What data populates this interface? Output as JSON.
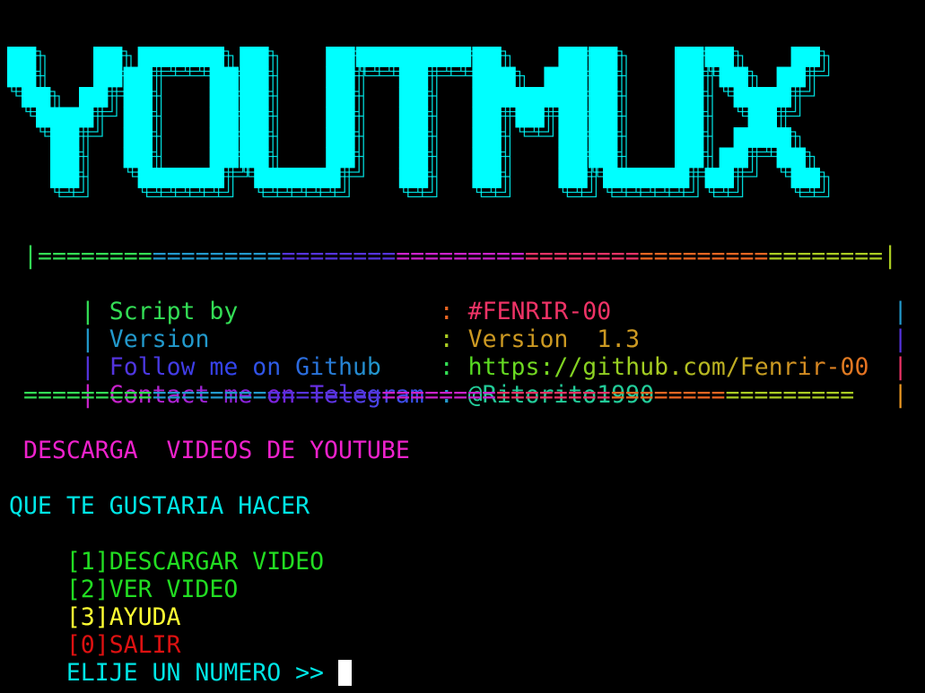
{
  "banner": {
    "title": "YOUTMUX",
    "color": "#00ffff"
  },
  "info_box": {
    "border_top": "|===========================================================|",
    "border_bottom": "==========================================================",
    "rows": [
      {
        "label": "Script by",
        "value": "#FENRIR-00"
      },
      {
        "label": "Version",
        "value": "Version  1.3"
      },
      {
        "label": "Follow me on Github",
        "value": "https://github.com/Fenrir-00"
      },
      {
        "label": "Contact me on Telegram",
        "value": "@Ritorito1990"
      }
    ]
  },
  "subtitle": "DESCARGA  VIDEOS DE YOUTUBE",
  "menu": {
    "prompt_title": "QUE TE GUSTARIA HACER",
    "options": [
      {
        "key": "[1]",
        "label": "DESCARGAR VIDEO",
        "color": "#22dd22"
      },
      {
        "key": "[2]",
        "label": "VER VIDEO",
        "color": "#22dd22"
      },
      {
        "key": "[3]",
        "label": "AYUDA",
        "color": "#ffff33"
      },
      {
        "key": "[0]",
        "label": "SALIR",
        "color": "#dd1111"
      }
    ],
    "input_prompt": "ELIJE UN NUMERO >> ",
    "input_value": ""
  },
  "colors": {
    "cyan": "#00e5e5",
    "green": "#22dd22",
    "magenta": "#ee22cc",
    "rainbow": [
      "#33dd55",
      "#2299cc",
      "#5533dd",
      "#cc22cc",
      "#ee3366",
      "#ee6622",
      "#aacc22"
    ]
  }
}
